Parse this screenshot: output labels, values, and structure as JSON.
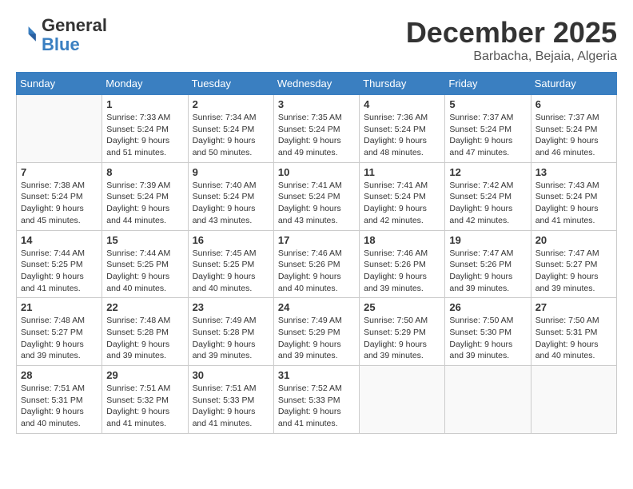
{
  "header": {
    "logo": {
      "general": "General",
      "blue": "Blue"
    },
    "title": "December 2025",
    "location": "Barbacha, Bejaia, Algeria"
  },
  "calendar": {
    "days_of_week": [
      "Sunday",
      "Monday",
      "Tuesday",
      "Wednesday",
      "Thursday",
      "Friday",
      "Saturday"
    ],
    "weeks": [
      [
        {
          "day": "",
          "sunrise": "",
          "sunset": "",
          "daylight": ""
        },
        {
          "day": "1",
          "sunrise": "7:33 AM",
          "sunset": "5:24 PM",
          "daylight": "9 hours and 51 minutes."
        },
        {
          "day": "2",
          "sunrise": "7:34 AM",
          "sunset": "5:24 PM",
          "daylight": "9 hours and 50 minutes."
        },
        {
          "day": "3",
          "sunrise": "7:35 AM",
          "sunset": "5:24 PM",
          "daylight": "9 hours and 49 minutes."
        },
        {
          "day": "4",
          "sunrise": "7:36 AM",
          "sunset": "5:24 PM",
          "daylight": "9 hours and 48 minutes."
        },
        {
          "day": "5",
          "sunrise": "7:37 AM",
          "sunset": "5:24 PM",
          "daylight": "9 hours and 47 minutes."
        },
        {
          "day": "6",
          "sunrise": "7:37 AM",
          "sunset": "5:24 PM",
          "daylight": "9 hours and 46 minutes."
        }
      ],
      [
        {
          "day": "7",
          "sunrise": "7:38 AM",
          "sunset": "5:24 PM",
          "daylight": "9 hours and 45 minutes."
        },
        {
          "day": "8",
          "sunrise": "7:39 AM",
          "sunset": "5:24 PM",
          "daylight": "9 hours and 44 minutes."
        },
        {
          "day": "9",
          "sunrise": "7:40 AM",
          "sunset": "5:24 PM",
          "daylight": "9 hours and 43 minutes."
        },
        {
          "day": "10",
          "sunrise": "7:41 AM",
          "sunset": "5:24 PM",
          "daylight": "9 hours and 43 minutes."
        },
        {
          "day": "11",
          "sunrise": "7:41 AM",
          "sunset": "5:24 PM",
          "daylight": "9 hours and 42 minutes."
        },
        {
          "day": "12",
          "sunrise": "7:42 AM",
          "sunset": "5:24 PM",
          "daylight": "9 hours and 42 minutes."
        },
        {
          "day": "13",
          "sunrise": "7:43 AM",
          "sunset": "5:24 PM",
          "daylight": "9 hours and 41 minutes."
        }
      ],
      [
        {
          "day": "14",
          "sunrise": "7:44 AM",
          "sunset": "5:25 PM",
          "daylight": "9 hours and 41 minutes."
        },
        {
          "day": "15",
          "sunrise": "7:44 AM",
          "sunset": "5:25 PM",
          "daylight": "9 hours and 40 minutes."
        },
        {
          "day": "16",
          "sunrise": "7:45 AM",
          "sunset": "5:25 PM",
          "daylight": "9 hours and 40 minutes."
        },
        {
          "day": "17",
          "sunrise": "7:46 AM",
          "sunset": "5:26 PM",
          "daylight": "9 hours and 40 minutes."
        },
        {
          "day": "18",
          "sunrise": "7:46 AM",
          "sunset": "5:26 PM",
          "daylight": "9 hours and 39 minutes."
        },
        {
          "day": "19",
          "sunrise": "7:47 AM",
          "sunset": "5:26 PM",
          "daylight": "9 hours and 39 minutes."
        },
        {
          "day": "20",
          "sunrise": "7:47 AM",
          "sunset": "5:27 PM",
          "daylight": "9 hours and 39 minutes."
        }
      ],
      [
        {
          "day": "21",
          "sunrise": "7:48 AM",
          "sunset": "5:27 PM",
          "daylight": "9 hours and 39 minutes."
        },
        {
          "day": "22",
          "sunrise": "7:48 AM",
          "sunset": "5:28 PM",
          "daylight": "9 hours and 39 minutes."
        },
        {
          "day": "23",
          "sunrise": "7:49 AM",
          "sunset": "5:28 PM",
          "daylight": "9 hours and 39 minutes."
        },
        {
          "day": "24",
          "sunrise": "7:49 AM",
          "sunset": "5:29 PM",
          "daylight": "9 hours and 39 minutes."
        },
        {
          "day": "25",
          "sunrise": "7:50 AM",
          "sunset": "5:29 PM",
          "daylight": "9 hours and 39 minutes."
        },
        {
          "day": "26",
          "sunrise": "7:50 AM",
          "sunset": "5:30 PM",
          "daylight": "9 hours and 39 minutes."
        },
        {
          "day": "27",
          "sunrise": "7:50 AM",
          "sunset": "5:31 PM",
          "daylight": "9 hours and 40 minutes."
        }
      ],
      [
        {
          "day": "28",
          "sunrise": "7:51 AM",
          "sunset": "5:31 PM",
          "daylight": "9 hours and 40 minutes."
        },
        {
          "day": "29",
          "sunrise": "7:51 AM",
          "sunset": "5:32 PM",
          "daylight": "9 hours and 41 minutes."
        },
        {
          "day": "30",
          "sunrise": "7:51 AM",
          "sunset": "5:33 PM",
          "daylight": "9 hours and 41 minutes."
        },
        {
          "day": "31",
          "sunrise": "7:52 AM",
          "sunset": "5:33 PM",
          "daylight": "9 hours and 41 minutes."
        },
        {
          "day": "",
          "sunrise": "",
          "sunset": "",
          "daylight": ""
        },
        {
          "day": "",
          "sunrise": "",
          "sunset": "",
          "daylight": ""
        },
        {
          "day": "",
          "sunrise": "",
          "sunset": "",
          "daylight": ""
        }
      ]
    ]
  }
}
